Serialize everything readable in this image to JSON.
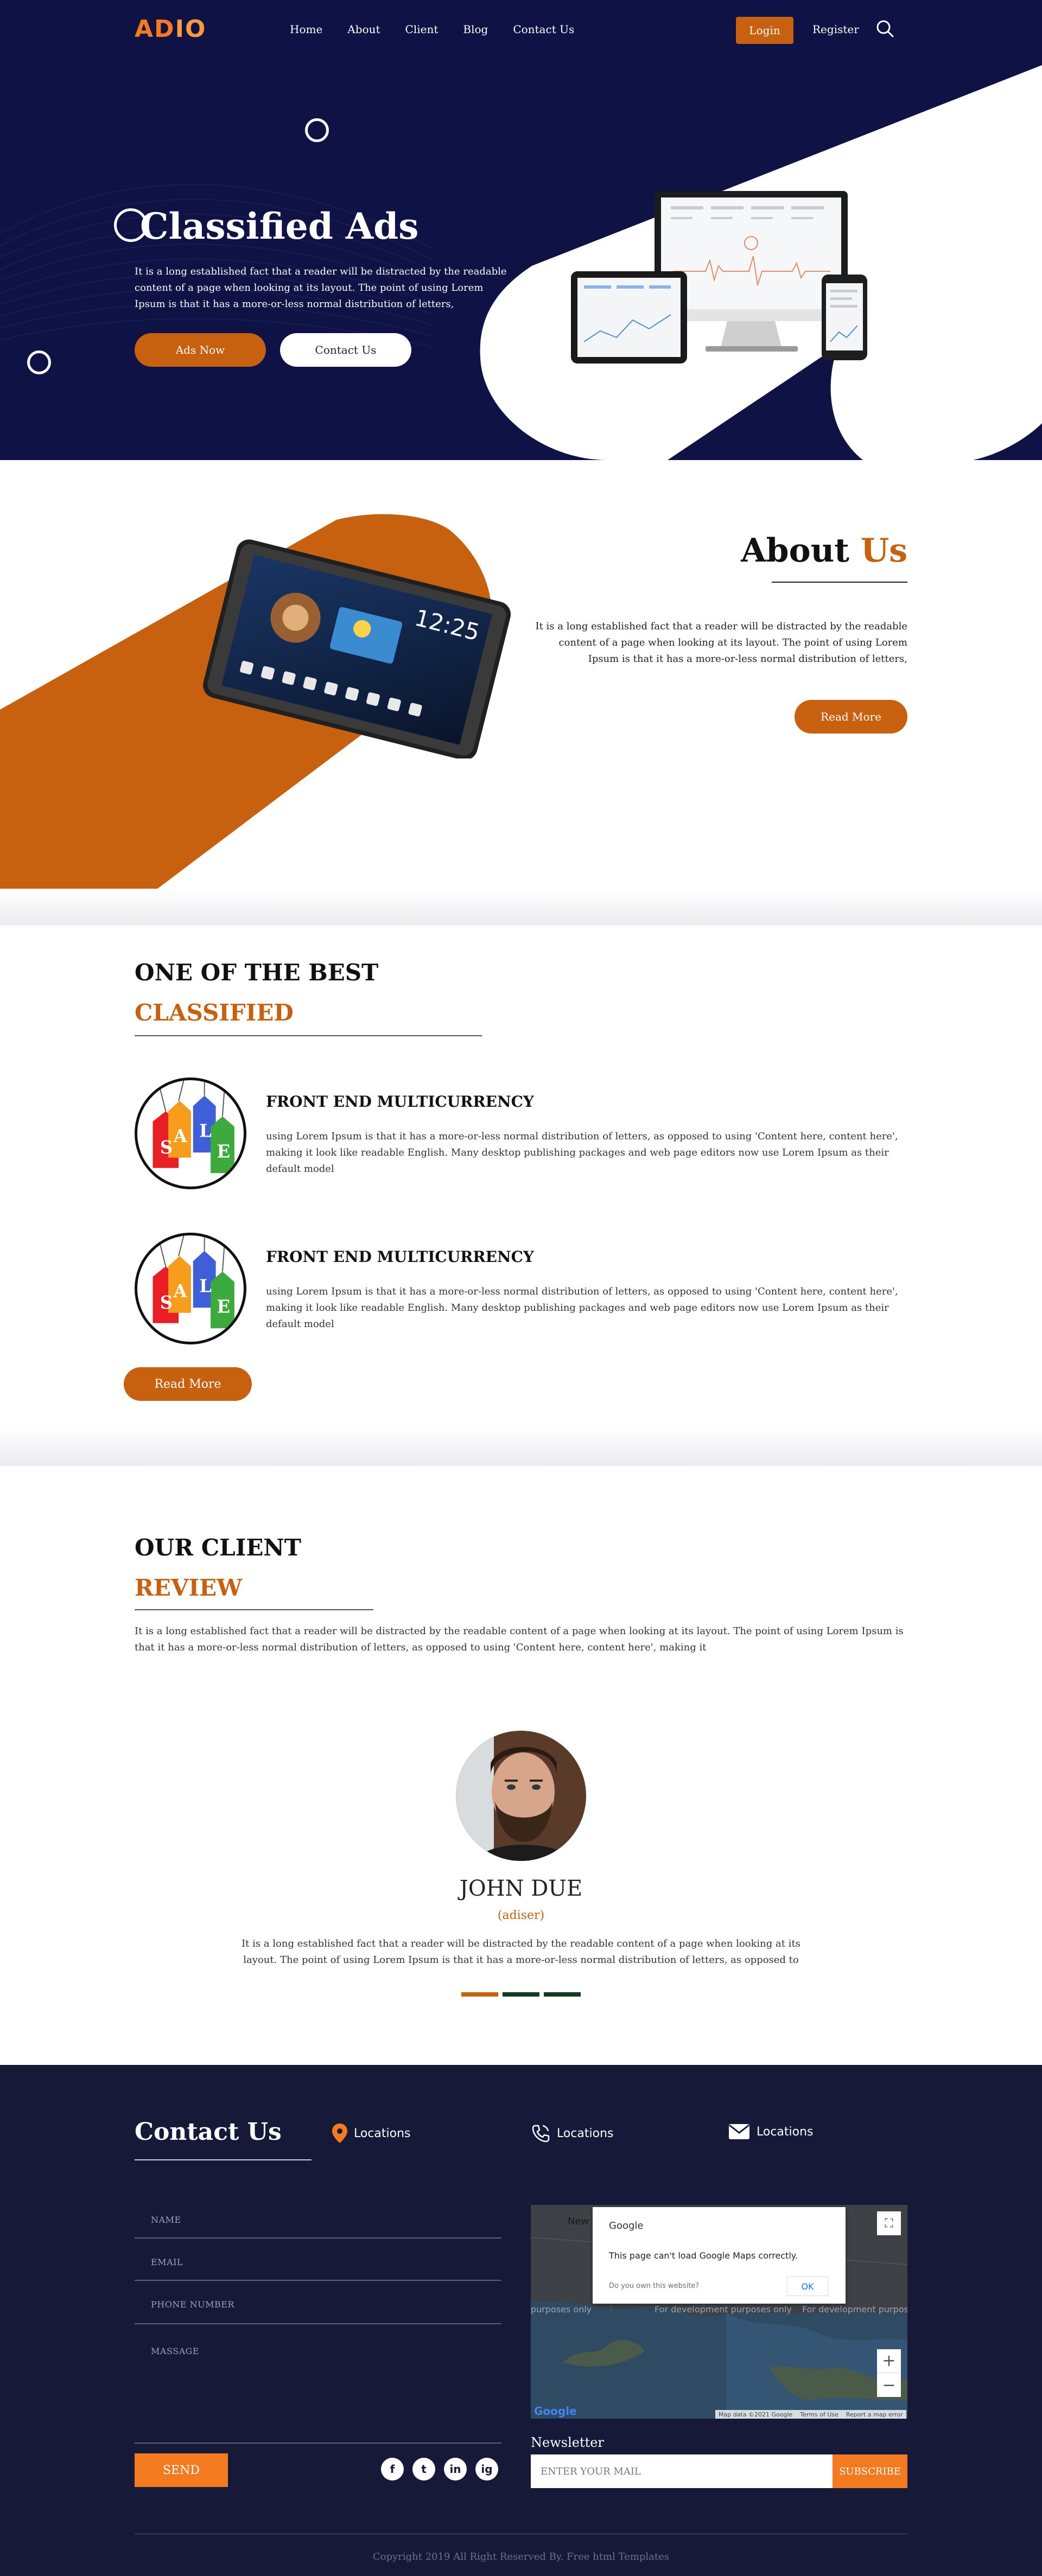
{
  "nav": {
    "logo_part1": "AD",
    "logo_part2": "IO",
    "menu": [
      "Home",
      "About",
      "Client",
      "Blog",
      "Contact Us"
    ],
    "login": "Login",
    "register": "Register"
  },
  "hero": {
    "title": "Classified Ads",
    "text": "It is a long established fact that a reader will be distracted by the readable content of a page when looking at its layout. The point of using Lorem Ipsum is that it has a more-or-less normal distribution of letters,",
    "btn_ads": "Ads Now",
    "btn_contact": "Contact Us"
  },
  "about": {
    "title_1": "About",
    "title_2": "Us",
    "text": "It is a long established fact that a reader will be distracted by the readable content of a page when looking at its layout. The point of using Lorem Ipsum is that it has a more-or-less normal distribution of letters,",
    "btn": "Read More"
  },
  "best": {
    "heading_1": "ONE OF THE BEST",
    "heading_2": "CLASSIFIED",
    "features": [
      {
        "title": "FRONT END MULTICURRENCY",
        "text": "using Lorem Ipsum is that it has a more-or-less normal distribution of letters, as opposed to using 'Content here, content here', making it look like readable English. Many desktop publishing packages and web page editors now use Lorem Ipsum as their default model"
      },
      {
        "title": "FRONT END MULTICURRENCY",
        "text": "using Lorem Ipsum is that it has a more-or-less normal distribution of letters, as opposed to using 'Content here, content here', making it look like readable English. Many desktop publishing packages and web page editors now use Lorem Ipsum as their default model"
      }
    ],
    "tag_letters": [
      "S",
      "A",
      "L",
      "E"
    ],
    "btn": "Read More"
  },
  "client": {
    "heading_1": "OUR CLIENT",
    "heading_2": "REVIEW",
    "text": "It is a long established fact that a reader will be distracted by the readable content of a page when looking at its layout. The point of using Lorem Ipsum is that it has a more-or-less normal distribution of letters, as opposed to using 'Content here, content here', making it",
    "name": "JOHN DUE",
    "role": "(adiser)",
    "quote": "It is a long established fact that a reader will be distracted by the readable content of a page when looking at its layout. The point of using Lorem Ipsum is that it has a more-or-less normal distribution of letters, as opposed to"
  },
  "footer": {
    "contact_title": "Contact Us",
    "locations": [
      "Locations",
      "Locations",
      "Locations"
    ],
    "fields": [
      "NAME",
      "EMAIL",
      "PHONE NUMBER",
      "MASSAGE"
    ],
    "send": "SEND",
    "socials": [
      "f",
      "t",
      "in",
      "ig"
    ],
    "map": {
      "dialog_brand": "Google",
      "dialog_message": "This page can't load Google Maps correctly.",
      "dialog_question": "Do you own this website?",
      "dialog_ok": "OK",
      "attrib_1": "Map data ©2021 Google",
      "attrib_2": "Terms of Use",
      "attrib_3": "Report a map error",
      "logo": "Google",
      "zoom_in": "+",
      "zoom_out": "−",
      "fullscreen": "⛶",
      "label_new": "New",
      "label_dev1": "purposes only",
      "label_dev2": "For development purposes only",
      "label_dev3": "For development purposes"
    },
    "newsletter_title": "Newsletter",
    "newsletter_placeholder": "ENTER YOUR MAIL",
    "subscribe": "SUBSCRIBE",
    "copyright": "Copyright 2019 All Right Reserved By. Free html Templates"
  },
  "colors": {
    "navy": "#0e1244",
    "orange": "#c7610f",
    "orange_bright": "#f47a20",
    "footer_bg": "#161a38"
  }
}
